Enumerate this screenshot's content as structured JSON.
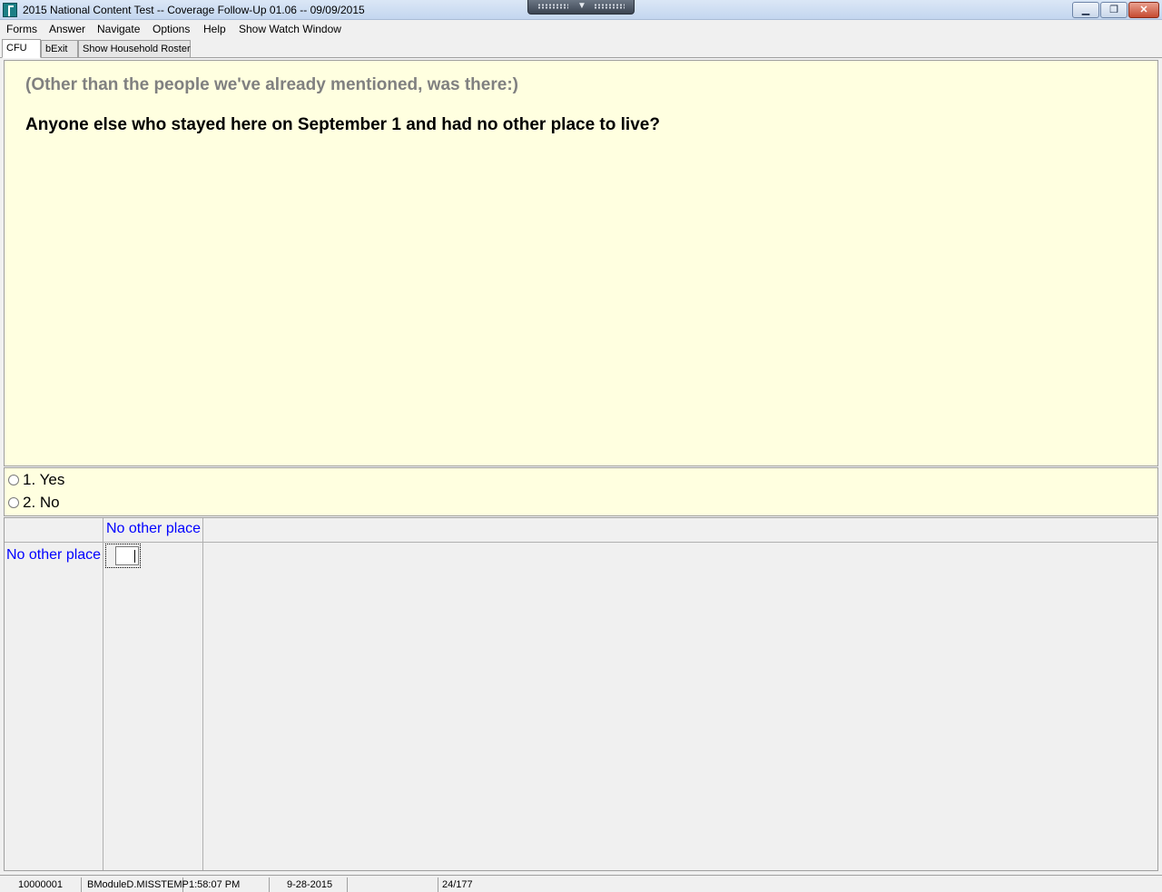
{
  "window": {
    "title": "2015 National Content Test -- Coverage Follow-Up 01.06 -- 09/09/2015",
    "minimize_glyph": "▁",
    "maximize_glyph": "❐",
    "close_glyph": "✕"
  },
  "menu": {
    "items": [
      "Forms",
      "Answer",
      "Navigate",
      "Options",
      "Help",
      "Show Watch Window"
    ]
  },
  "tabs": [
    {
      "label": "CFU",
      "active": true
    },
    {
      "label": "bExit",
      "active": false
    },
    {
      "label": "Show Household Roster",
      "active": false
    }
  ],
  "question": {
    "intro": "(Other than the people we've already mentioned, was there:)",
    "text": "Anyone else who stayed here on September 1 and had no other place to live?"
  },
  "answers": {
    "options": [
      {
        "label": "1. Yes",
        "selected": false
      },
      {
        "label": "2. No",
        "selected": false
      }
    ]
  },
  "grid": {
    "column_header": "No other place",
    "row_header": "No other place",
    "cell_value": ""
  },
  "status": {
    "case_id": "10000001",
    "field": "BModuleD.MISSTEMP",
    "time": "1:58:07 PM",
    "date": "9-28-2015",
    "blank": "",
    "page": "24/177"
  },
  "colors": {
    "question_bg": "#ffffe0",
    "intro_text": "#808080",
    "grid_label": "#0000ff"
  }
}
